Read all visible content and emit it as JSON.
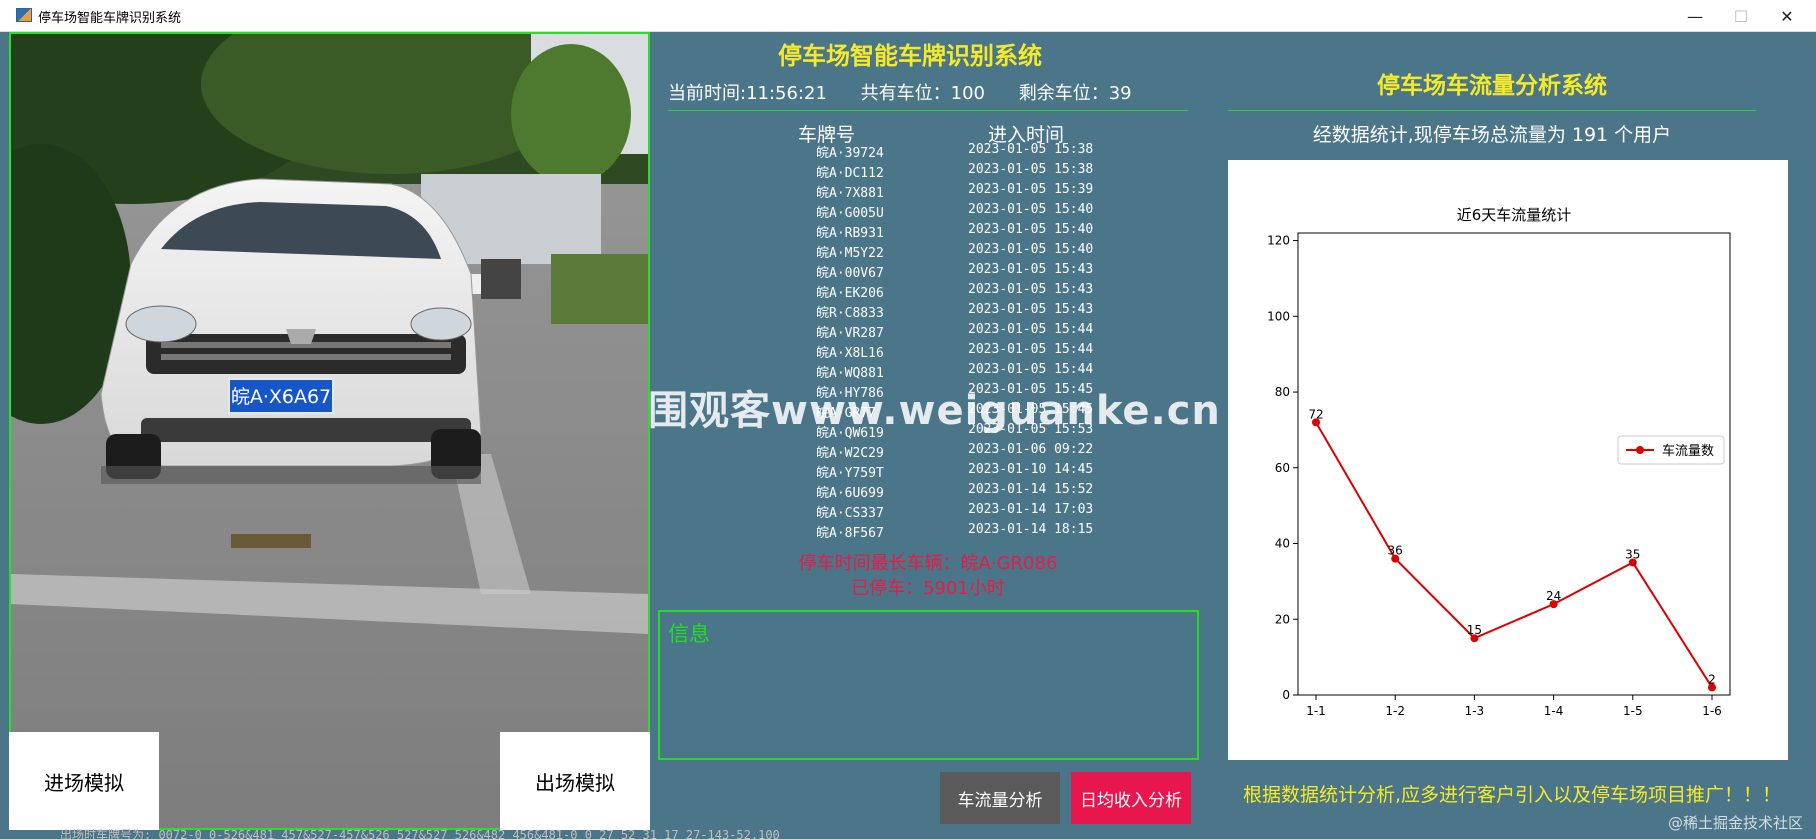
{
  "window": {
    "title": "停车场智能车牌识别系统",
    "controls": {
      "minimize": "—",
      "maximize": "☐",
      "close": "✕"
    }
  },
  "camera": {
    "plate_text": "皖A·X6A67",
    "enter_button": "进场模拟",
    "exit_button": "出场模拟"
  },
  "main": {
    "title": "停车场智能车牌识别系统",
    "current_time_label": "当前时间:11:56:21",
    "total_spaces_label": "共有车位：100",
    "remaining_spaces_label": "剩余车位：39",
    "columns": {
      "plate": "车牌号",
      "time": "进入时间"
    },
    "rows": [
      {
        "plate": "皖A·39724",
        "time": "2023-01-05 15:38"
      },
      {
        "plate": "皖A·DC112",
        "time": "2023-01-05 15:38"
      },
      {
        "plate": "皖A·7X881",
        "time": "2023-01-05 15:39"
      },
      {
        "plate": "皖A·G005U",
        "time": "2023-01-05 15:40"
      },
      {
        "plate": "皖A·RB931",
        "time": "2023-01-05 15:40"
      },
      {
        "plate": "皖A·M5Y22",
        "time": "2023-01-05 15:40"
      },
      {
        "plate": "皖A·00V67",
        "time": "2023-01-05 15:43"
      },
      {
        "plate": "皖A·EK206",
        "time": "2023-01-05 15:43"
      },
      {
        "plate": "皖R·C8833",
        "time": "2023-01-05 15:43"
      },
      {
        "plate": "皖A·VR287",
        "time": "2023-01-05 15:44"
      },
      {
        "plate": "皖A·X8L16",
        "time": "2023-01-05 15:44"
      },
      {
        "plate": "皖A·WQ881",
        "time": "2023-01-05 15:44"
      },
      {
        "plate": "皖A·HY786",
        "time": "2023-01-05 15:45"
      },
      {
        "plate": "皖A·GR77",
        "time": "2023-01-05 15:45"
      },
      {
        "plate": "皖A·QW619",
        "time": "2023-01-05 15:53"
      },
      {
        "plate": "皖A·W2C29",
        "time": "2023-01-06 09:22"
      },
      {
        "plate": "皖A·Y759T",
        "time": "2023-01-10 14:45"
      },
      {
        "plate": "皖A·6U699",
        "time": "2023-01-14 15:52"
      },
      {
        "plate": "皖A·CS337",
        "time": "2023-01-14 17:03"
      },
      {
        "plate": "皖A·8F567",
        "time": "2023-01-14 18:15"
      }
    ],
    "longest_label": "停车时间最长车辆：皖A·GR086",
    "parked_label": "已停车：5901小时",
    "info_label": "信息",
    "flow_button": "车流量分析",
    "income_button": "日均收入分析"
  },
  "right": {
    "title": "停车场车流量分析系统",
    "stat_line": "经数据统计,现停车场总流量为 191 个用户",
    "advice": "根据数据统计分析,应多进行客户引入以及停车场项目推广！！！"
  },
  "chart_data": {
    "type": "line",
    "title": "近6天车流量统计",
    "categories": [
      "1-1",
      "1-2",
      "1-3",
      "1-4",
      "1-5",
      "1-6"
    ],
    "series": [
      {
        "name": "车流量数",
        "values": [
          72,
          36,
          15,
          24,
          35,
          2
        ],
        "color": "#dd0000"
      }
    ],
    "y_ticks": [
      0,
      20,
      40,
      60,
      80,
      100,
      120
    ],
    "ylim": [
      0,
      122
    ],
    "legend_position": "right",
    "grid": false,
    "xlabel": "",
    "ylabel": ""
  },
  "overlay": {
    "watermark": "围观客www.weiguanke.cn",
    "footer_mark": "@稀土掘金技术社区",
    "bottom_log": "出场时车牌号为: 0072-0 0-526&481 457&527-457&526 527&527 526&482 456&481-0 0 27 52 31 17 27-143-52.100"
  }
}
